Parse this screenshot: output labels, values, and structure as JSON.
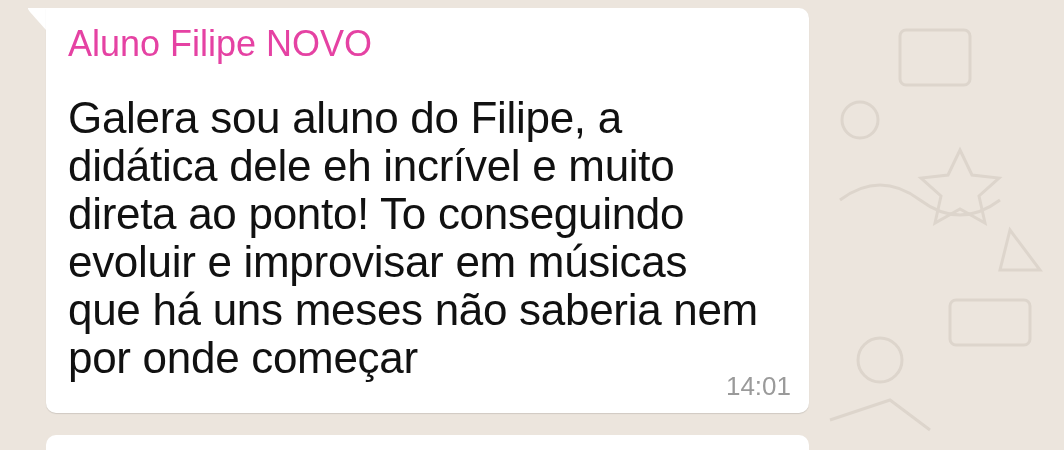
{
  "message": {
    "sender": "Aluno Filipe NOVO",
    "text": "Galera sou aluno do Filipe, a\ndidática dele eh incrível e muito\ndireta ao ponto! To conseguindo\nevoluir e improvisar em músicas\nque há uns meses não saberia nem\npor onde começar",
    "time": "14:01"
  },
  "next_message": {
    "kind": "bubble"
  }
}
